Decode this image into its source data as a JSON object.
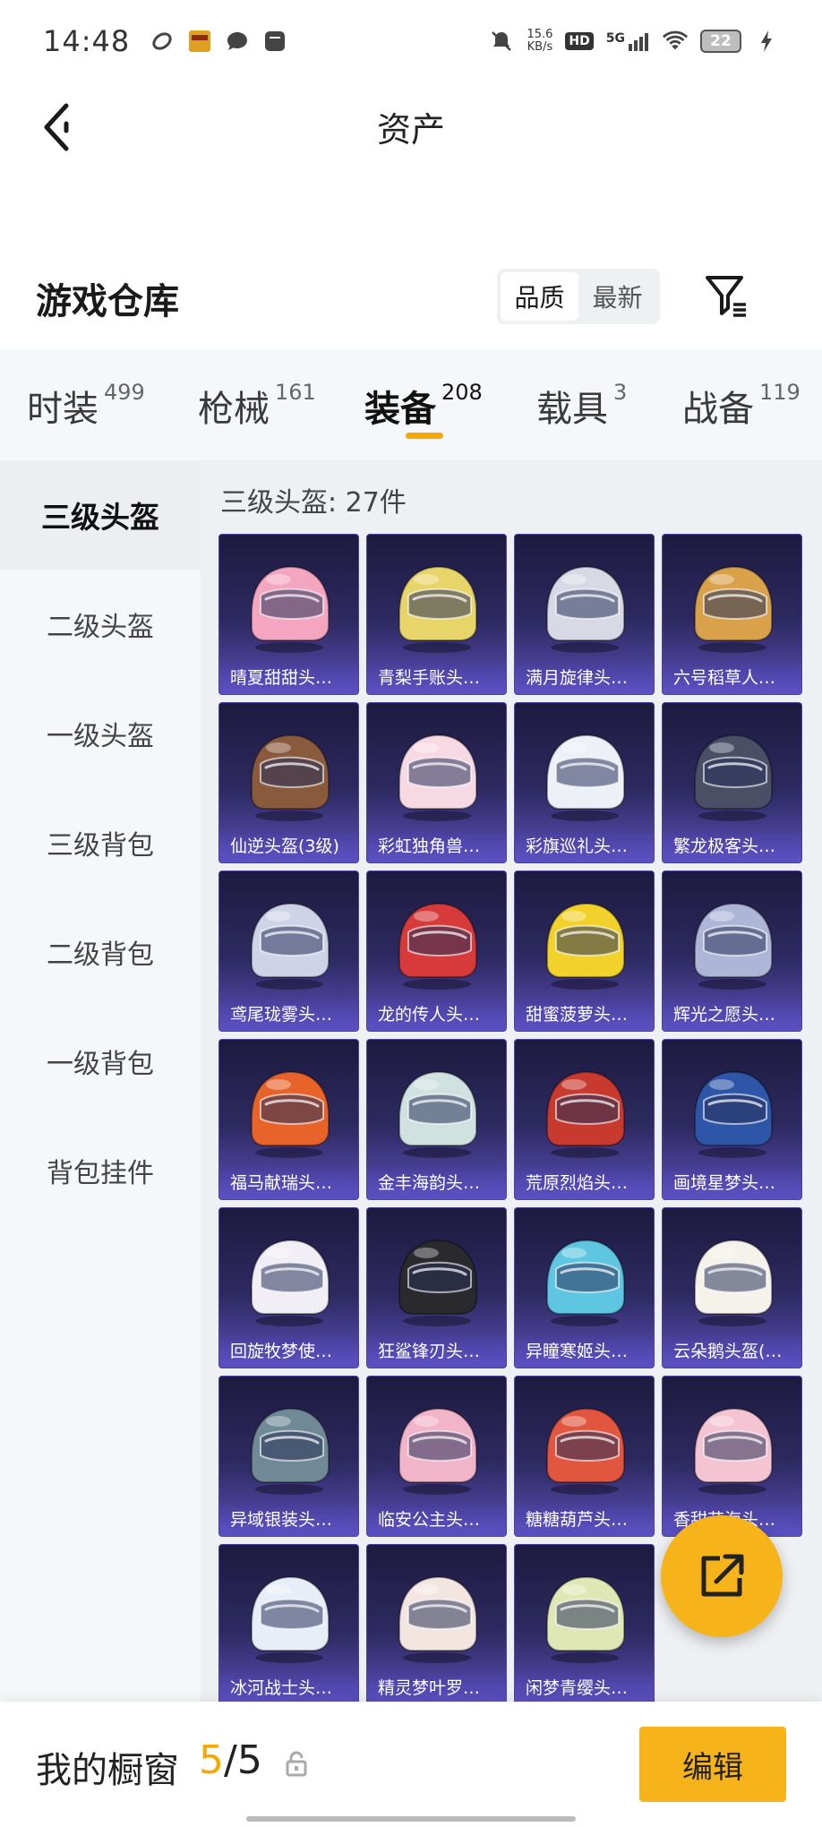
{
  "status_bar": {
    "time": "14:48",
    "net_speed_value": "15.6",
    "net_speed_unit": "KB/s",
    "hd": "HD",
    "signal": "5G",
    "battery": "22"
  },
  "header": {
    "title": "资产"
  },
  "warehouse": {
    "title": "游戏仓库",
    "sort_options": [
      "品质",
      "最新"
    ],
    "sort_selected": "品质"
  },
  "tabs": [
    {
      "label": "时装",
      "count": "499"
    },
    {
      "label": "枪械",
      "count": "161"
    },
    {
      "label": "装备",
      "count": "208",
      "active": true
    },
    {
      "label": "载具",
      "count": "3"
    },
    {
      "label": "战备",
      "count": "119"
    }
  ],
  "sidebar": {
    "items": [
      "三级头盔",
      "二级头盔",
      "一级头盔",
      "三级背包",
      "二级背包",
      "一级背包",
      "背包挂件"
    ],
    "selected": "三级头盔"
  },
  "content": {
    "header": "三级头盔: 27件",
    "items": [
      {
        "name": "晴夏甜甜头…",
        "color": "#f4a6c0"
      },
      {
        "name": "青梨手账头…",
        "color": "#e8d56a"
      },
      {
        "name": "满月旋律头…",
        "color": "#d9d9e6"
      },
      {
        "name": "六号稻草人…",
        "color": "#d9a24a"
      },
      {
        "name": "仙逆头盔(3级)",
        "color": "#8a5a3c"
      },
      {
        "name": "彩虹独角兽…",
        "color": "#f7d9e4"
      },
      {
        "name": "彩旗巡礼头…",
        "color": "#eef0f8"
      },
      {
        "name": "繁龙极客头…",
        "color": "#4a4f66"
      },
      {
        "name": "鸢尾珑雾头…",
        "color": "#cfd3e8"
      },
      {
        "name": "龙的传人头…",
        "color": "#d63a3a"
      },
      {
        "name": "甜蜜菠萝头…",
        "color": "#f2d22a"
      },
      {
        "name": "辉光之愿头…",
        "color": "#aeb6d8"
      },
      {
        "name": "福马献瑞头…",
        "color": "#e8632a"
      },
      {
        "name": "金丰海韵头…",
        "color": "#cfe2e0"
      },
      {
        "name": "荒原烈焰头…",
        "color": "#c83a2e"
      },
      {
        "name": "画境星梦头…",
        "color": "#2e56a8"
      },
      {
        "name": "回旋牧梦使…",
        "color": "#f1eef6"
      },
      {
        "name": "狂鲨锋刃头…",
        "color": "#2a2a2e"
      },
      {
        "name": "异瞳寒姬头…",
        "color": "#5fc6e2"
      },
      {
        "name": "云朵鹅头盔(…",
        "color": "#f4f2ea"
      },
      {
        "name": "异域银装头…",
        "color": "#6f8a96"
      },
      {
        "name": "临安公主头…",
        "color": "#f2b4c8"
      },
      {
        "name": "糖糖葫芦头…",
        "color": "#e2553e"
      },
      {
        "name": "香甜花海头…",
        "color": "#f5c4d2"
      },
      {
        "name": "冰河战士头…",
        "color": "#e8eef8"
      },
      {
        "name": "精灵梦叶罗…",
        "color": "#f3e6e0"
      },
      {
        "name": "闲梦青缨头…",
        "color": "#dfe8b4"
      }
    ]
  },
  "bottom_bar": {
    "title": "我的橱窗",
    "count_current": "5",
    "count_total": "/5",
    "edit_label": "编辑"
  },
  "colors": {
    "accent": "#f5a800",
    "card_top": "#1c1a3e",
    "card_bottom": "#5c4fb8"
  },
  "icons": {
    "back": "chevron-left-icon",
    "filter": "filter-icon",
    "share": "share-external-icon",
    "lock": "lock-icon"
  }
}
